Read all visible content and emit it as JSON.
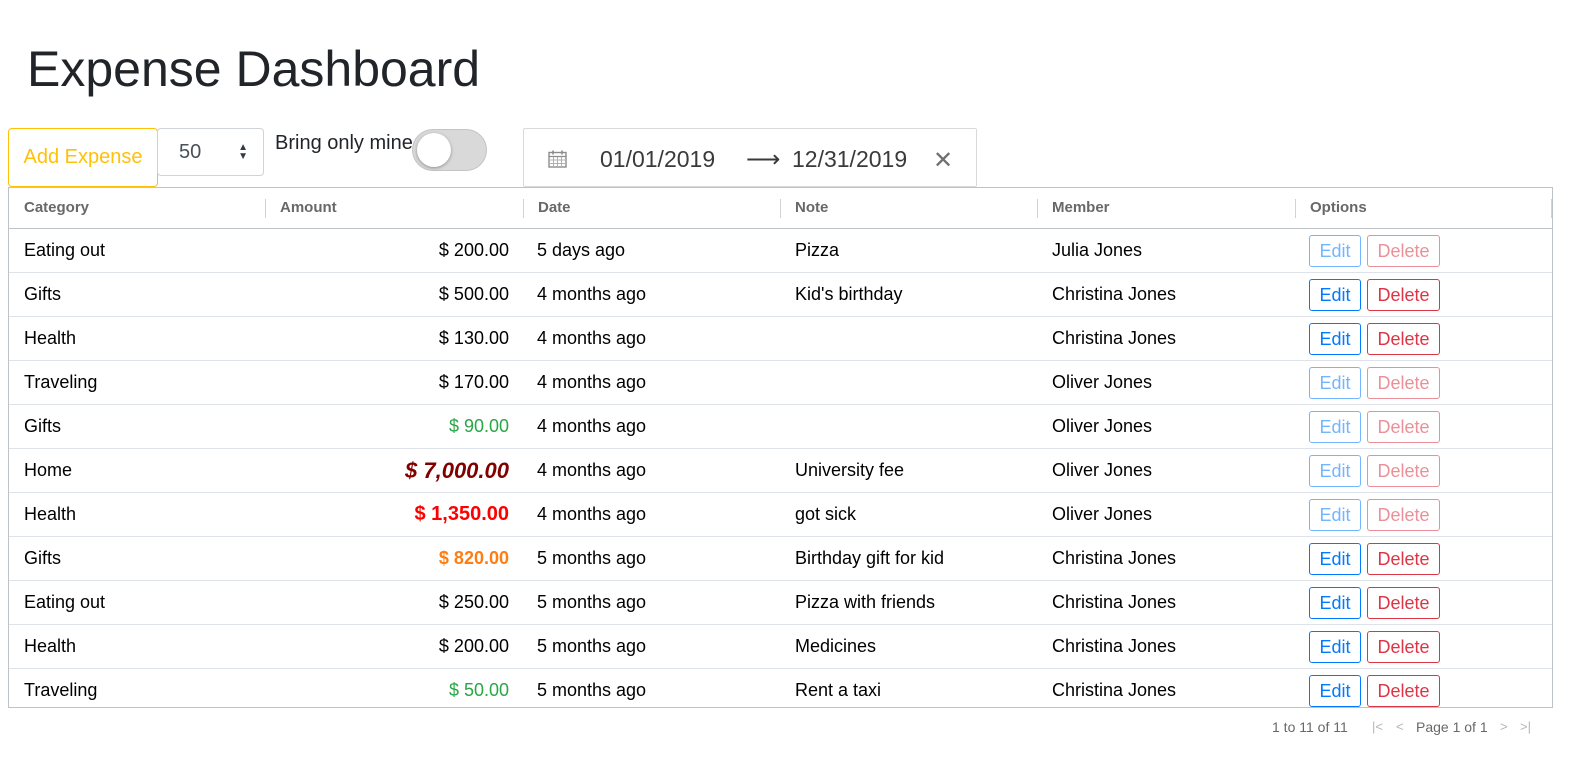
{
  "page_title": "Expense Dashboard",
  "toolbar": {
    "add_label": "Add Expense",
    "page_size": "50",
    "mine_label": "Bring only mine",
    "mine_on": false
  },
  "date_range": {
    "start": "01/01/2019",
    "end": "12/31/2019"
  },
  "table": {
    "headers": [
      "Category",
      "Amount",
      "Date",
      "Note",
      "Member",
      "Options"
    ],
    "rows": [
      {
        "category": "Eating out",
        "amount": "$ 200.00",
        "date": "5 days ago",
        "note": "Pizza",
        "member": "Julia Jones",
        "style": "normal",
        "enabled": false
      },
      {
        "category": "Gifts",
        "amount": "$ 500.00",
        "date": "4 months ago",
        "note": "Kid's birthday",
        "member": "Christina Jones",
        "style": "normal",
        "enabled": true
      },
      {
        "category": "Health",
        "amount": "$ 130.00",
        "date": "4 months ago",
        "note": "",
        "member": "Christina Jones",
        "style": "normal",
        "enabled": true
      },
      {
        "category": "Traveling",
        "amount": "$ 170.00",
        "date": "4 months ago",
        "note": "",
        "member": "Oliver Jones",
        "style": "normal",
        "enabled": false
      },
      {
        "category": "Gifts",
        "amount": "$ 90.00",
        "date": "4 months ago",
        "note": "",
        "member": "Oliver Jones",
        "style": "green",
        "enabled": false
      },
      {
        "category": "Home",
        "amount": "$ 7,000.00",
        "date": "4 months ago",
        "note": "University fee",
        "member": "Oliver Jones",
        "style": "dark",
        "enabled": false
      },
      {
        "category": "Health",
        "amount": "$ 1,350.00",
        "date": "4 months ago",
        "note": "got sick",
        "member": "Oliver Jones",
        "style": "red",
        "enabled": false
      },
      {
        "category": "Gifts",
        "amount": "$ 820.00",
        "date": "5 months ago",
        "note": "Birthday gift for kid",
        "member": "Christina Jones",
        "style": "orange",
        "enabled": true
      },
      {
        "category": "Eating out",
        "amount": "$ 250.00",
        "date": "5 months ago",
        "note": "Pizza with friends",
        "member": "Christina Jones",
        "style": "normal",
        "enabled": true
      },
      {
        "category": "Health",
        "amount": "$ 200.00",
        "date": "5 months ago",
        "note": "Medicines",
        "member": "Christina Jones",
        "style": "normal",
        "enabled": true
      },
      {
        "category": "Traveling",
        "amount": "$ 50.00",
        "date": "5 months ago",
        "note": "Rent a taxi",
        "member": "Christina Jones",
        "style": "green",
        "enabled": true
      }
    ],
    "edit_label": "Edit",
    "delete_label": "Delete"
  },
  "pagination": {
    "summary": "1 to 11 of 11",
    "page_label": "Page 1 of 1"
  },
  "colors": {
    "warning": "#ffc107",
    "primary": "#007bff",
    "danger": "#dc3545",
    "success": "#28a745",
    "orange": "#fd7e14",
    "red": "#ff0000",
    "dark_red": "#800000"
  },
  "icons": [
    "calendar-icon",
    "arrow-right-icon",
    "close-icon",
    "sort-arrows-icon",
    "first-page-icon",
    "prev-page-icon",
    "next-page-icon",
    "last-page-icon"
  ]
}
